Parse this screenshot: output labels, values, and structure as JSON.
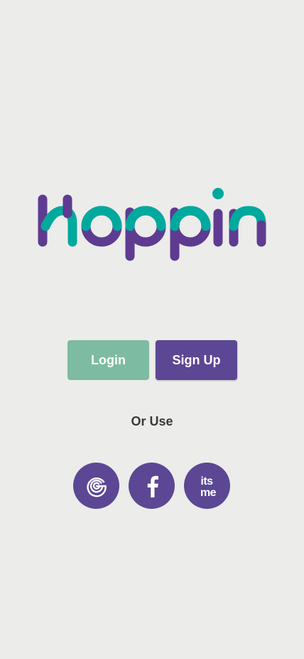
{
  "brand": {
    "logo_text": "hoppin",
    "colors": {
      "teal": "#00a99d",
      "purple": "#5e3b91",
      "background": "#ececea"
    }
  },
  "auth": {
    "login_label": "Login",
    "signup_label": "Sign Up",
    "login_color": "#7dbba2",
    "signup_color": "#5b4794"
  },
  "alt_login": {
    "divider_text": "Or Use",
    "providers": [
      {
        "name": "Google",
        "icon": "google-icon"
      },
      {
        "name": "Facebook",
        "icon": "facebook-icon"
      },
      {
        "name": "itsme",
        "icon": "itsme-icon",
        "icon_text": [
          "its",
          "me"
        ]
      }
    ]
  }
}
